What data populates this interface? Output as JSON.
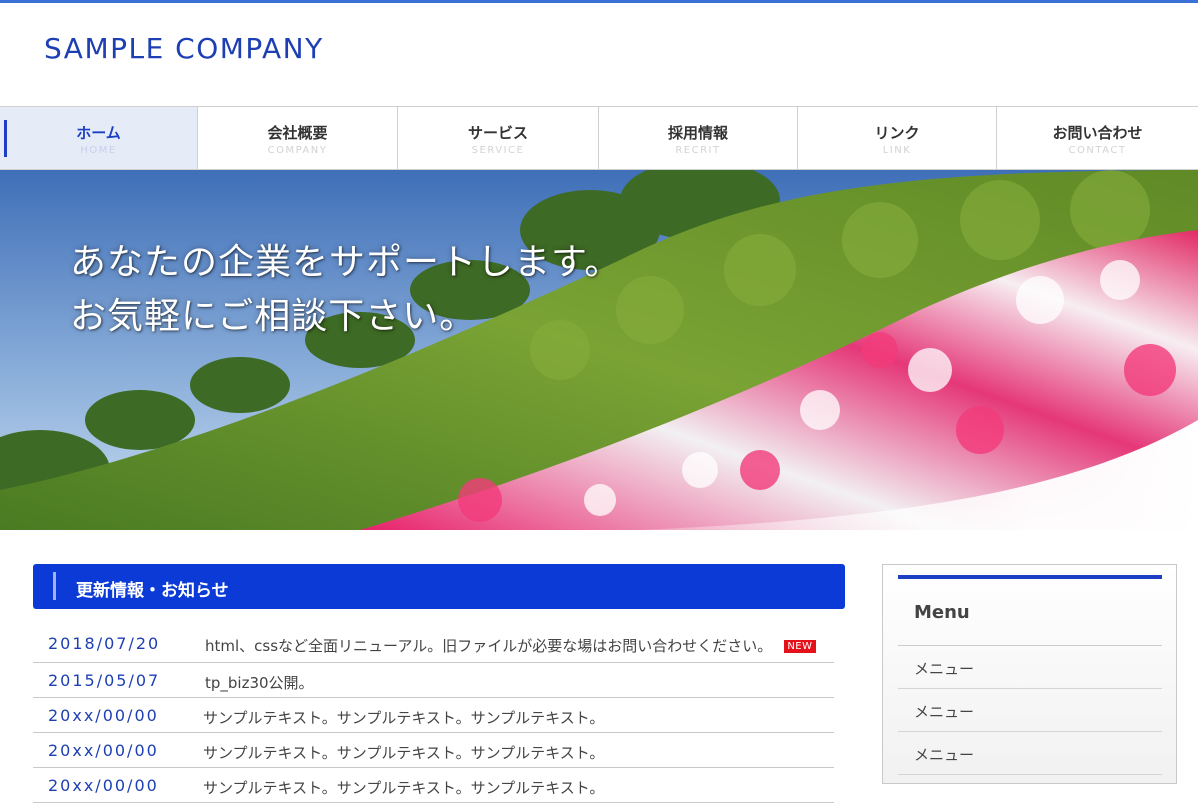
{
  "header": {
    "logo_text": "SAMPLE COMPANY"
  },
  "nav": {
    "items": [
      {
        "label": "ホーム",
        "sub": "HOME",
        "active": true
      },
      {
        "label": "会社概要",
        "sub": "COMPANY"
      },
      {
        "label": "サービス",
        "sub": "SERVICE"
      },
      {
        "label": "採用情報",
        "sub": "RECRIT"
      },
      {
        "label": "リンク",
        "sub": "LINK"
      },
      {
        "label": "お問い合わせ",
        "sub": "CONTACT"
      }
    ]
  },
  "hero": {
    "line1": "あなたの企業をサポートします。",
    "line2": "お気軽にご相談下さい。"
  },
  "news": {
    "heading": "更新情報・お知らせ",
    "new_badge": "NEW",
    "items": [
      {
        "date": "2018/07/20",
        "text": "html、cssなど全面リニューアル。旧ファイルが必要な場はお問い合わせください。"
      },
      {
        "date": "2015/05/07",
        "text": "tp_biz30公開。"
      },
      {
        "date": "20xx/00/00",
        "text": "サンプルテキスト。サンプルテキスト。サンプルテキスト。"
      },
      {
        "date": "20xx/00/00",
        "text": "サンプルテキスト。サンプルテキスト。サンプルテキスト。"
      },
      {
        "date": "20xx/00/00",
        "text": "サンプルテキスト。サンプルテキスト。サンプルテキスト。"
      }
    ]
  },
  "sidebar": {
    "title": "Menu",
    "items": [
      {
        "label": "メニュー"
      },
      {
        "label": "メニュー"
      },
      {
        "label": "メニュー"
      }
    ]
  },
  "colors": {
    "accent": "#1c3fc4",
    "heading_bg": "#0c3ad6",
    "logo": "#1d3fb3",
    "badge_new": "#e4111b",
    "nav_active_bg": "#e6ebf8"
  }
}
